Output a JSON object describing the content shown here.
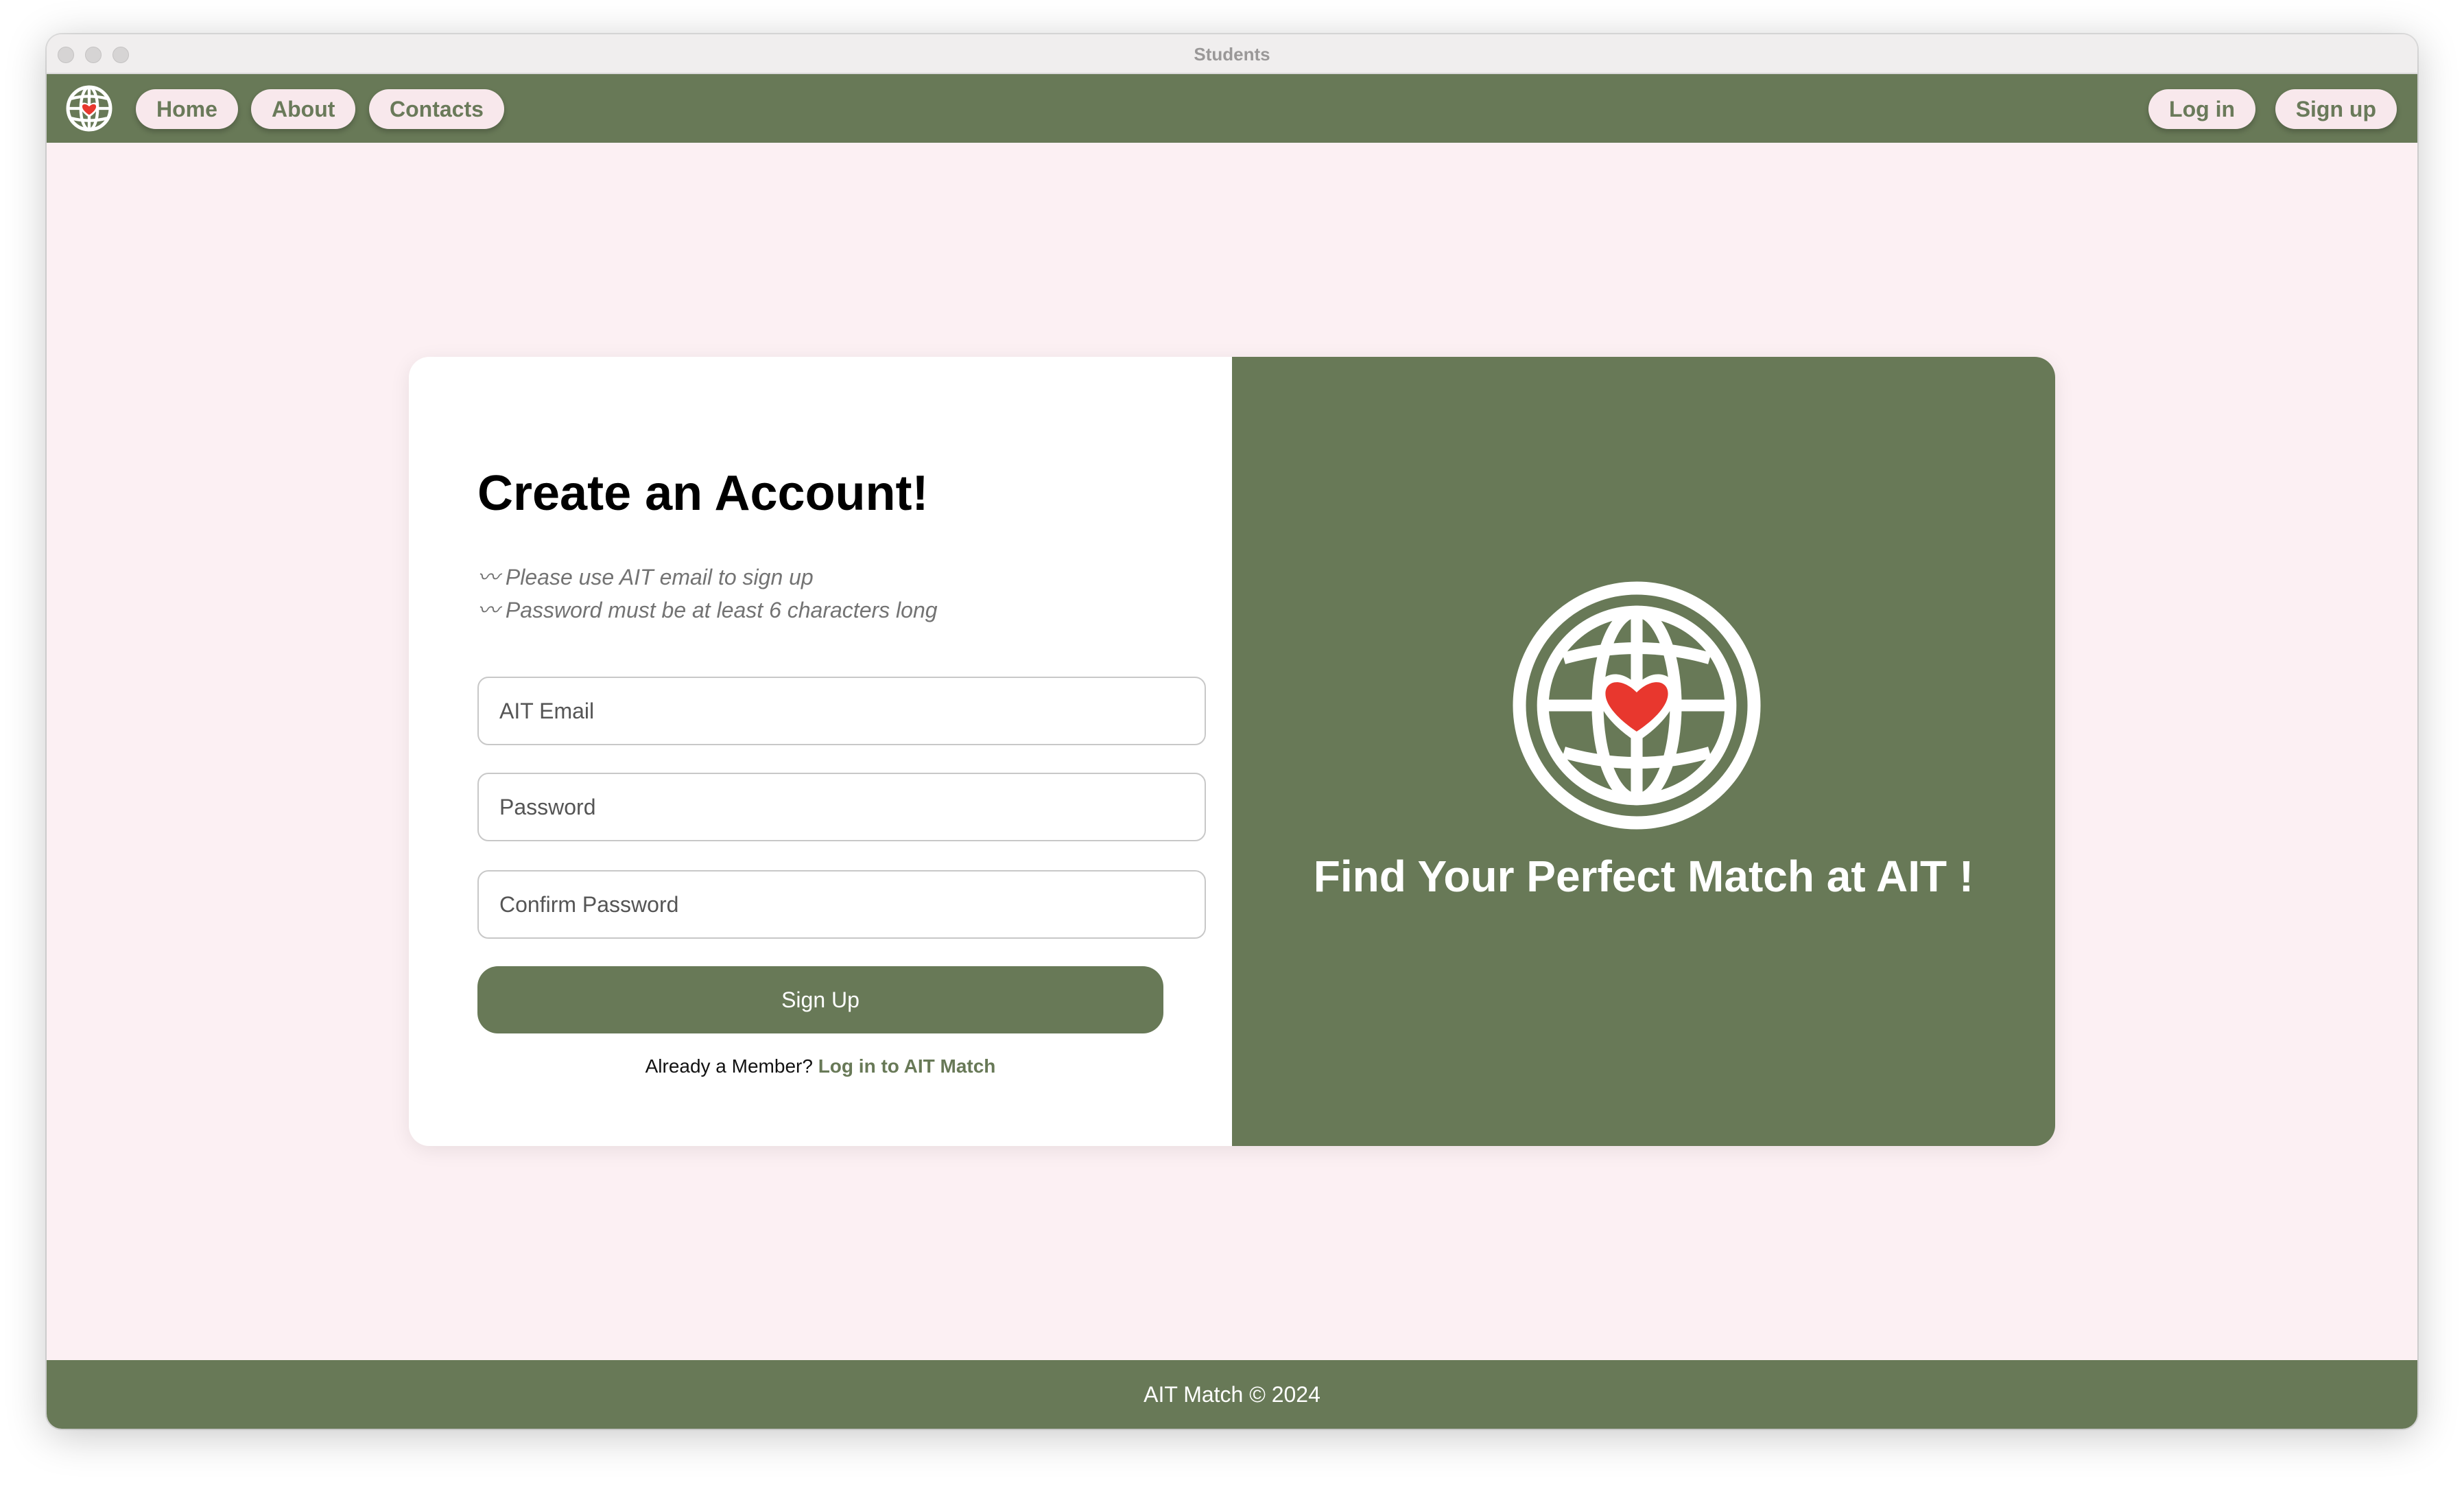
{
  "window": {
    "title": "Students"
  },
  "nav": {
    "logo_icon": "globe-heart-icon",
    "home": "Home",
    "about": "About",
    "contacts": "Contacts",
    "login": "Log in",
    "signup": "Sign up"
  },
  "form": {
    "heading": "Create an Account!",
    "hint_1": "〰 Please use AIT email to sign up",
    "hint_2": "〰 Password must be at least 6 characters long",
    "email_placeholder": "AIT Email",
    "password_placeholder": "Password",
    "confirm_placeholder": "Confirm Password",
    "submit_label": "Sign Up",
    "member_text": "Already a Member? ",
    "member_link": "Log in to AIT Match"
  },
  "hero": {
    "logo_icon": "globe-heart-icon",
    "tagline": "Find Your Perfect Match at AIT !"
  },
  "footer": {
    "text": "AIT Match © 2024"
  },
  "colors": {
    "brand_green": "#687957",
    "page_bg": "#fcf0f3",
    "pill_bg": "#f8e8ec",
    "heart_red": "#e8372e"
  }
}
